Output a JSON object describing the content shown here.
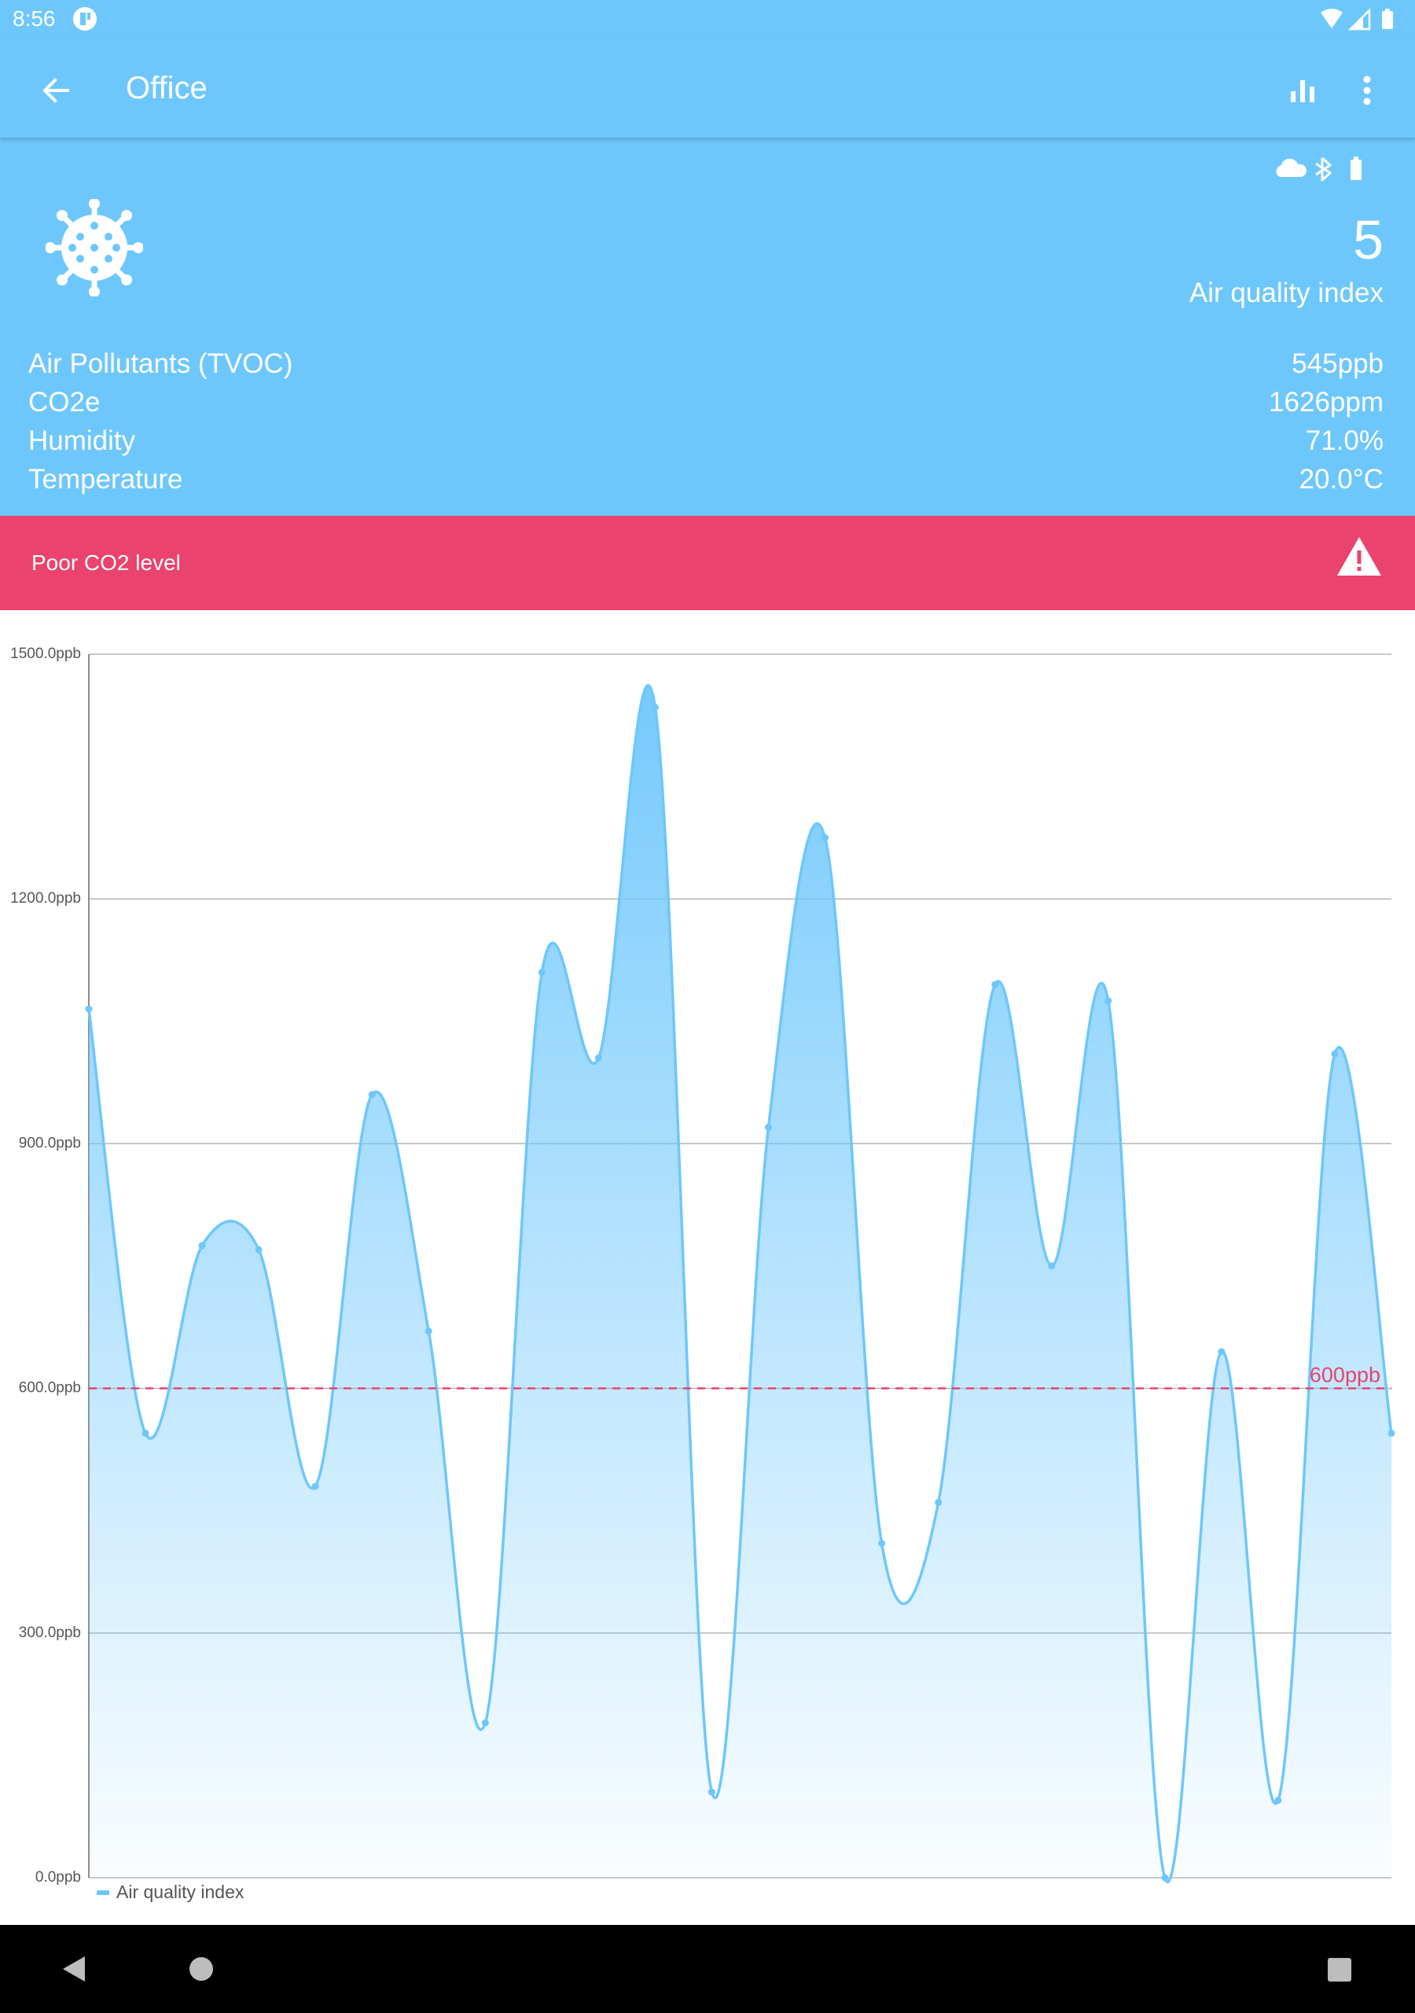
{
  "status_bar": {
    "time": "8:56"
  },
  "app_bar": {
    "title": "Office"
  },
  "summary": {
    "aqi_value": "5",
    "aqi_label": "Air quality index",
    "metrics": [
      {
        "label": "Air Pollutants (TVOC)",
        "value": "545ppb"
      },
      {
        "label": "CO2e",
        "value": "1626ppm"
      },
      {
        "label": "Humidity",
        "value": "71.0%"
      },
      {
        "label": "Temperature",
        "value": "20.0°C"
      }
    ]
  },
  "alert": {
    "text": "Poor CO2 level"
  },
  "colors": {
    "primary": "#6ec7fc",
    "alert": "#e9436e",
    "line": "#6ec7fc",
    "threshold": "#e9436e"
  },
  "icons": [
    "wifi-icon",
    "cell-signal-icon",
    "battery-icon",
    "back-arrow-icon",
    "bar-chart-icon",
    "more-vert-icon",
    "cloud-icon",
    "bluetooth-icon",
    "virus-icon",
    "warning-icon"
  ],
  "chart_data": {
    "type": "area",
    "ylim": [
      0,
      1500
    ],
    "y_ticks": [
      "0.0ppb",
      "300.0ppb",
      "600.0ppb",
      "900.0ppb",
      "1200.0ppb",
      "1500.0ppb"
    ],
    "y_tick_values": [
      0,
      300,
      600,
      900,
      1200,
      1500
    ],
    "threshold": {
      "value": 600,
      "label": "600ppb"
    },
    "grid": true,
    "legend_position": "bottom-left",
    "series": [
      {
        "name": "Air quality index",
        "values": [
          1065,
          545,
          775,
          770,
          480,
          960,
          670,
          190,
          1110,
          1005,
          1435,
          105,
          920,
          1275,
          410,
          460,
          1095,
          750,
          1075,
          0,
          645,
          95,
          1010,
          545
        ]
      }
    ]
  }
}
